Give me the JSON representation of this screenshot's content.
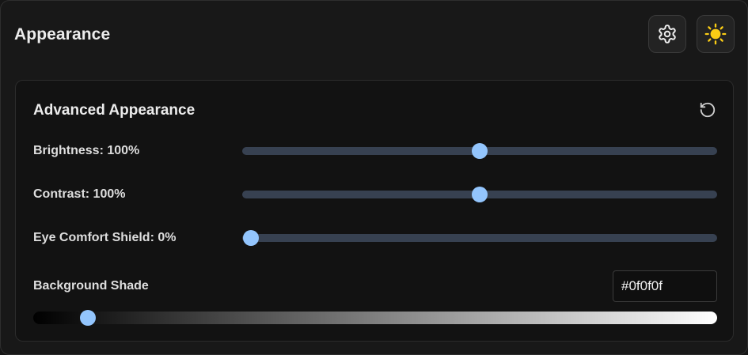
{
  "header": {
    "title": "Appearance",
    "settings_icon": "gear-icon",
    "theme_icon": "sun-icon",
    "theme_icon_color": "#facc15"
  },
  "advanced": {
    "title": "Advanced Appearance",
    "reset_icon": "reset-icon",
    "brightness": {
      "label": "Brightness: 100%",
      "value": 100,
      "min": 0,
      "max": 200
    },
    "contrast": {
      "label": "Contrast: 100%",
      "value": 100,
      "min": 0,
      "max": 200
    },
    "eye_comfort": {
      "label": "Eye Comfort Shield: 0%",
      "value": 0,
      "min": 0,
      "max": 100
    },
    "background_shade": {
      "label": "Background Shade",
      "hex_value": "#0f0f0f",
      "level": 0.07
    }
  },
  "colors": {
    "accent": "#93c5fd",
    "track": "#374151"
  }
}
